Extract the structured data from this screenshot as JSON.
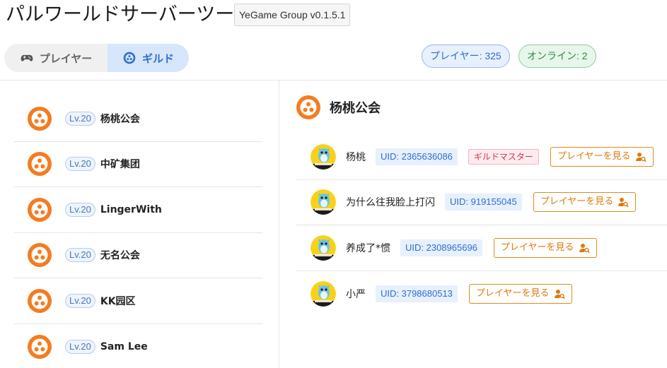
{
  "app": {
    "title": "パルワールドサーバーツール",
    "version": "YeGame Group v0.1.5.1"
  },
  "tabs": [
    {
      "label": "プレイヤー",
      "icon": "gamepad-icon",
      "active": false
    },
    {
      "label": "ギルド",
      "icon": "guild-icon",
      "active": true
    }
  ],
  "stats": {
    "players": "プレイヤー: 325",
    "online": "オンライン: 2"
  },
  "colors": {
    "accent": "#2f6fd1",
    "guild_icon": "#f47c20",
    "online": "#2e8a44",
    "view_button": "#e07a0a",
    "role_badge": "#d2334f"
  },
  "guilds": [
    {
      "level": "Lv.20",
      "name": "杨桃公会"
    },
    {
      "level": "Lv.20",
      "name": "中矿集团"
    },
    {
      "level": "Lv.20",
      "name": "LingerWith"
    },
    {
      "level": "Lv.20",
      "name": "无名公会"
    },
    {
      "level": "Lv.20",
      "name": "KK园区"
    },
    {
      "level": "Lv.20",
      "name": "Sam Lee"
    }
  ],
  "detail": {
    "title": "杨桃公会",
    "view_label": "プレイヤーを見る",
    "members": [
      {
        "name": "杨桃",
        "uid": "UID: 2365636086",
        "role": "ギルドマスター"
      },
      {
        "name": "为什么往我脸上打闪",
        "uid": "UID: 919155045",
        "role": ""
      },
      {
        "name": "养成了*惯",
        "uid": "UID: 2308965696",
        "role": ""
      },
      {
        "name": "小严",
        "uid": "UID: 3798680513",
        "role": ""
      }
    ]
  }
}
